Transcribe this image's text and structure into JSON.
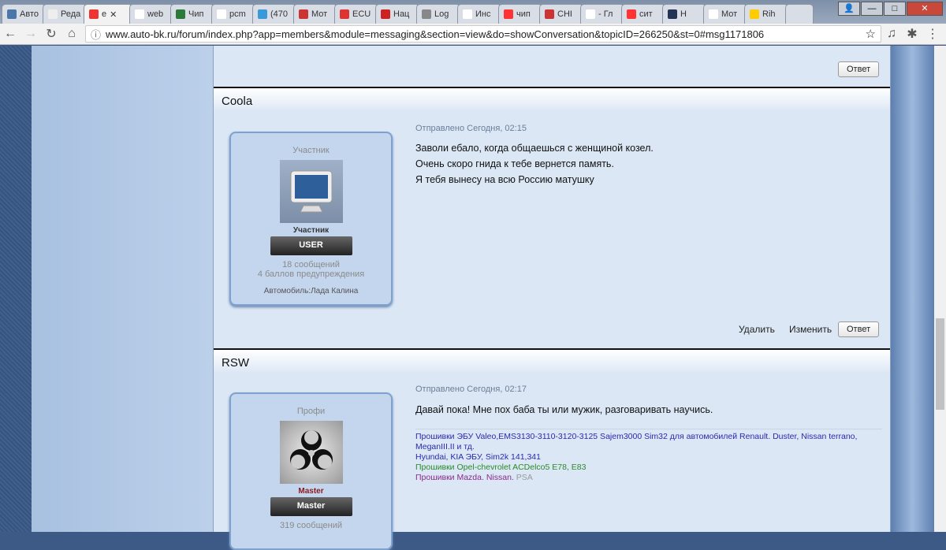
{
  "browser": {
    "tabs": [
      {
        "label": "Авто",
        "icon": "vk-icon"
      },
      {
        "label": "Реда",
        "icon": "fr-icon"
      },
      {
        "label": "e",
        "icon": "star-icon",
        "active": true
      },
      {
        "label": "web",
        "icon": "page-icon"
      },
      {
        "label": "Чип",
        "icon": "sms-icon"
      },
      {
        "label": "pcm",
        "icon": "page-icon"
      },
      {
        "label": "(470",
        "icon": "mail-icon"
      },
      {
        "label": "Мот",
        "icon": "gt-icon"
      },
      {
        "label": "ECU",
        "icon": "et-icon"
      },
      {
        "label": "Нац",
        "icon": "flower-icon"
      },
      {
        "label": "Log",
        "icon": "log-icon"
      },
      {
        "label": "Инс",
        "icon": "page-icon"
      },
      {
        "label": "чип",
        "icon": "yandex-icon"
      },
      {
        "label": "CHI",
        "icon": "gt-icon"
      },
      {
        "label": "- Гл",
        "icon": "page-icon"
      },
      {
        "label": "сит",
        "icon": "yandex-icon"
      },
      {
        "label": "Н",
        "icon": "game-icon"
      },
      {
        "label": "Мот",
        "icon": "page-icon"
      },
      {
        "label": "Rih",
        "icon": "play-icon"
      }
    ],
    "url": "www.auto-bk.ru/forum/index.php?app=members&module=messaging&section=view&do=showConversation&topicID=266250&st=0#msg1171806"
  },
  "prev_post": {
    "reply": "Ответ"
  },
  "posts": [
    {
      "author": "Coola",
      "rank": "Участник",
      "group_name": "Участник",
      "group_badge": "USER",
      "stats": [
        "18 сообщений",
        "4 баллов предупреждения"
      ],
      "car": "Автомобиль:Лада Калина",
      "sent": "Отправлено Сегодня, 02:15",
      "lines": [
        "Заволи ебало, когда общаешься с женщиной козел.",
        "Очень скоро гнида к тебе вернется память.",
        "Я тебя вынесу на всю Россию матушку"
      ],
      "actions": {
        "delete": "Удалить",
        "edit": "Изменить",
        "reply": "Ответ"
      }
    },
    {
      "author": "RSW",
      "rank": "Профи",
      "group_name": "Master",
      "group_badge": "Master",
      "stats": [
        "319 сообщений"
      ],
      "sent": "Отправлено Сегодня, 02:17",
      "lines": [
        "Давай пока! Мне пох баба ты или мужик, разговаривать научись."
      ],
      "signature": [
        {
          "text": "Прошивки ЭБУ Valeo,EMS3130-3110-3120-3125 Sajem3000 Sim32 для автомобилей Renault. Duster, Nissan terrano, MeganIII.II и тд.",
          "color": "#2a2ab0"
        },
        {
          "text": "Hyundai, KIA ЭБУ, Sim2k 141,341",
          "color": "#2a2ab0"
        },
        {
          "text": "Прошивки Opel-chevrolet ACDelco5 E78, E83",
          "color": "#2a8a2a"
        },
        {
          "text": "Прошивки Mazda. Nissan.",
          "color": "#8a2a8a"
        },
        {
          "text": "PSA",
          "color": "#999999"
        }
      ]
    }
  ]
}
